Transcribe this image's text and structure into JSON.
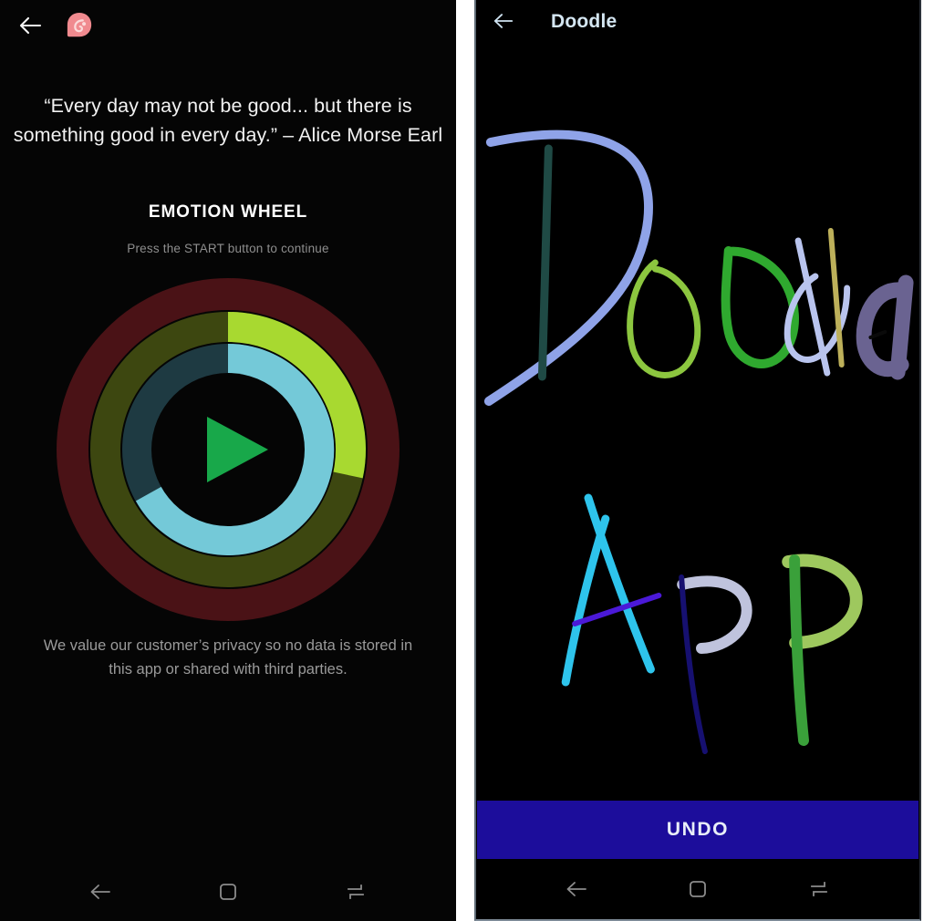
{
  "left_screen": {
    "topbar": {
      "back_icon": "back-arrow-icon",
      "logo_icon": "app-logo-pin-icon",
      "logo_color": "#f08a8f"
    },
    "quote": "“Every day may not be good... but there is something good in every day.”  – Alice Morse Earl",
    "wheel_title": "EMOTION WHEEL",
    "wheel_subtitle": "Press the START button to continue",
    "wheel": {
      "name": "emotion-wheel",
      "play_button_label": "START",
      "play_icon": "play-triangle-icon",
      "play_color": "#18a84a",
      "rings": [
        {
          "name": "outer-ring",
          "base_color": "#4a1216",
          "highlight_color": "#4a1216",
          "highlight_start_deg": 0,
          "highlight_end_deg": 0
        },
        {
          "name": "middle-ring",
          "base_color": "#3d4710",
          "highlight_color": "#a8d930",
          "highlight_start_deg": 0,
          "highlight_end_deg": 78
        },
        {
          "name": "inner-ring",
          "base_color": "#1e3a42",
          "highlight_color": "#74c9d8",
          "highlight_start_deg": 0,
          "highlight_end_deg": 302
        }
      ]
    },
    "privacy_notice": "We value our customer’s privacy so no data is stored in this app or shared with third parties."
  },
  "right_screen": {
    "topbar": {
      "back_icon": "back-arrow-icon",
      "title": "Doodle",
      "title_color": "#d4e6f2"
    },
    "canvas": {
      "name": "doodle-canvas",
      "drawn_text_top": "Doodle",
      "drawn_text_bottom": "App",
      "strokes": [
        {
          "letter": "D-curve",
          "color": "#8fa3e8"
        },
        {
          "letter": "D-stem",
          "color": "#1f4a45"
        },
        {
          "letter": "o-1",
          "color": "#8cc63f"
        },
        {
          "letter": "o-2",
          "color": "#2fa92f"
        },
        {
          "letter": "d-bowl",
          "color": "#b9c4ee"
        },
        {
          "letter": "d-stem",
          "color": "#bdb05a"
        },
        {
          "letter": "l",
          "color": "#bdb05a"
        },
        {
          "letter": "e",
          "color": "#6a6391"
        },
        {
          "letter": "A",
          "color": "#2ec4ec"
        },
        {
          "letter": "A-crossbar",
          "color": "#4b19d8"
        },
        {
          "letter": "p-1-bowl",
          "color": "#bfc3dd"
        },
        {
          "letter": "p-1-stem",
          "color": "#161070"
        },
        {
          "letter": "P-2-bowl",
          "color": "#9ec85e"
        },
        {
          "letter": "P-2-stem",
          "color": "#3aa03a"
        }
      ]
    },
    "undo_button": {
      "label": "UNDO",
      "bg_color": "#1c0d9b",
      "text_color": "#e8eef8"
    }
  },
  "navbar": {
    "back_label": "Back",
    "home_label": "Home",
    "recents_label": "Recent apps",
    "icons": [
      "nav-back-icon",
      "nav-home-icon",
      "nav-recents-icon"
    ]
  }
}
